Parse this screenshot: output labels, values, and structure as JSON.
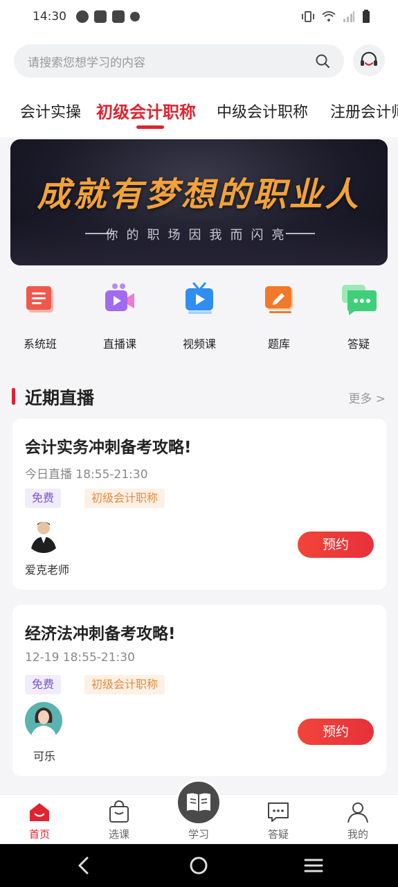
{
  "status_bar": {
    "time": "14:30"
  },
  "search": {
    "placeholder": "请搜索您想学习的内容"
  },
  "tabs": [
    {
      "label": "会计实操",
      "active": false
    },
    {
      "label": "初级会计职称",
      "active": true
    },
    {
      "label": "中级会计职称",
      "active": false
    },
    {
      "label": "注册会计师",
      "active": false
    }
  ],
  "banner": {
    "title": "成就有梦想的职业人",
    "subtitle": "你的职场因我而闪亮"
  },
  "categories": [
    {
      "label": "系统班",
      "icon": "book-icon",
      "color": "#f0584a"
    },
    {
      "label": "直播课",
      "icon": "live-camera-icon",
      "color": "#a06bf0"
    },
    {
      "label": "视频课",
      "icon": "tv-play-icon",
      "color": "#2f8ef0"
    },
    {
      "label": "题库",
      "icon": "edit-pad-icon",
      "color": "#f07a2a"
    },
    {
      "label": "答疑",
      "icon": "chat-bubble-icon",
      "color": "#3fcf7a"
    }
  ],
  "live_section": {
    "title": "近期直播",
    "more": "更多 >",
    "cards": [
      {
        "title": "会计实务冲刺备考攻略!",
        "time": "今日直播 18:55-21:30",
        "tags": [
          "免费",
          "初级会计职称"
        ],
        "teacher": "爱克老师",
        "button": "预约"
      },
      {
        "title": "经济法冲刺备考攻略!",
        "time": "12-19 18:55-21:30",
        "tags": [
          "免费",
          "初级会计职称"
        ],
        "teacher": "可乐",
        "button": "预约"
      }
    ]
  },
  "bottom_nav": [
    {
      "label": "首页",
      "icon": "home-icon",
      "active": true
    },
    {
      "label": "选课",
      "icon": "shopping-bag-icon",
      "active": false
    },
    {
      "label": "学习",
      "icon": "open-book-icon",
      "active": false
    },
    {
      "label": "答疑",
      "icon": "message-icon",
      "active": false
    },
    {
      "label": "我的",
      "icon": "user-icon",
      "active": false
    }
  ],
  "colors": {
    "accent": "#e0232f"
  }
}
